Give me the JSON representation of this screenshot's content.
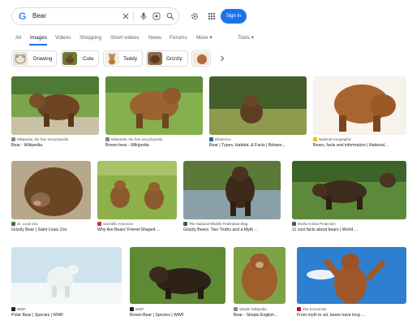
{
  "search": {
    "logo": "G",
    "query": "Bear"
  },
  "header": {
    "signin_label": "Sign in"
  },
  "tabs": [
    {
      "label": "All",
      "active": false
    },
    {
      "label": "Images",
      "active": true
    },
    {
      "label": "Videos",
      "active": false
    },
    {
      "label": "Shopping",
      "active": false
    },
    {
      "label": "Short videos",
      "active": false
    },
    {
      "label": "News",
      "active": false
    },
    {
      "label": "Forums",
      "active": false
    },
    {
      "label": "More ▾",
      "active": false
    },
    {
      "label": "Tools ▾",
      "active": false
    }
  ],
  "chips": [
    {
      "label": "Drawing"
    },
    {
      "label": "Cute"
    },
    {
      "label": "Teddy"
    },
    {
      "label": "Grizzly"
    }
  ],
  "results": [
    {
      "source": "Wikipedia, the free encyclopedia",
      "title": "Bear - Wikipedia"
    },
    {
      "source": "Wikipedia, the free encyclopedia",
      "title": "Brown bear - Wikipedia"
    },
    {
      "source": "Britannica",
      "title": "Bear | Types, Habitat, & Facts | Britann..."
    },
    {
      "source": "National Geographic",
      "title": "Bears, facts and information | National..."
    },
    {
      "source": "St. Louis Zoo",
      "title": "Grizzly Bear | Saint Louis Zoo"
    },
    {
      "source": "Scientific American",
      "title": "Why Are Bears' Friend-Shaped ..."
    },
    {
      "source": "The National Wildlife Federation Blog",
      "title": "Grizzly Bears: Two Truths and a Myth ..."
    },
    {
      "source": "World Animal Protection",
      "title": "11 cool facts about bears | World ..."
    },
    {
      "source": "WWF",
      "title": "Polar Bear | Species | WWF"
    },
    {
      "source": "WWF",
      "title": "Brown Bear | Species | WWF"
    },
    {
      "source": "Simple Wikipedia",
      "title": "Bear - Simple English..."
    },
    {
      "source": "The Economist",
      "title": "From myth to art, bears have long ..."
    }
  ],
  "colors": {
    "accent": "#1a73e8",
    "bear_brown": "#7a4a24",
    "grass": "#6f9a3a",
    "polar": "#eef2f3"
  }
}
